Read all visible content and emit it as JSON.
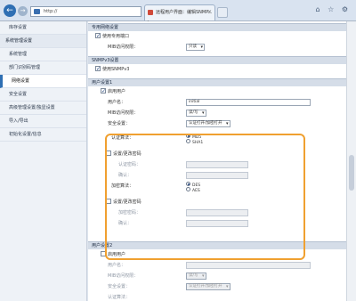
{
  "browser": {
    "url": "http://",
    "address_tools": "⍴ ▾ C",
    "tab_title": "远程用户界面：编辑SNMP...",
    "tab_close": "×",
    "window_icons": "⌂ ☆ ⚙"
  },
  "sidebar": {
    "items": [
      {
        "label": "库存设置"
      },
      {
        "label": "系统管理设置"
      },
      {
        "label": "系统管理"
      },
      {
        "label": "部门识别码管理"
      },
      {
        "label": "网络设置"
      },
      {
        "label": "安全设置"
      },
      {
        "label": "高级管理设置/独显设置"
      },
      {
        "label": "导入/导出"
      },
      {
        "label": "初始化设置/信息"
      }
    ]
  },
  "content": {
    "section_dedicated": "专用网络设置",
    "use_dedicated_port": "使用专用端口",
    "mib_access_label": "MIB访问权限：",
    "mib_access_value": "只读",
    "section_snmpv3": "SNMPv3设置",
    "use_snmpv3": "使用SNMPv3",
    "section_user1": "用户设置1",
    "enable_user": "启用用户",
    "username_label": "用户名：",
    "username_value": "initial",
    "mib_perm_label": "MIB访问权限：",
    "mib_perm_value": "读/写",
    "security_label": "安全设置：",
    "security_value": "认证打开/加密打开",
    "auth_algo_label": "认证算法：",
    "auth_opt1": "MD5",
    "auth_opt2": "SHA1",
    "set_change_pw": "设置/更改密码",
    "auth_pw_label": "认证密码：",
    "confirm_label": "确认：",
    "enc_algo_label": "加密算法：",
    "enc_opt1": "DES",
    "enc_opt2": "AES",
    "set_change_pw2": "设置/更改密码",
    "enc_pw_label": "加密密码：",
    "confirm_label2": "确认：",
    "section_user2": "用户设置2",
    "enable_user2": "启用用户",
    "username_label2": "用户名：",
    "mib_perm_label2": "MIB访问权限：",
    "mib_perm_value2": "读/写",
    "security_label2": "安全设置：",
    "security_value2": "认证打开/加密打开",
    "auth_algo_label2": "认证算法："
  }
}
